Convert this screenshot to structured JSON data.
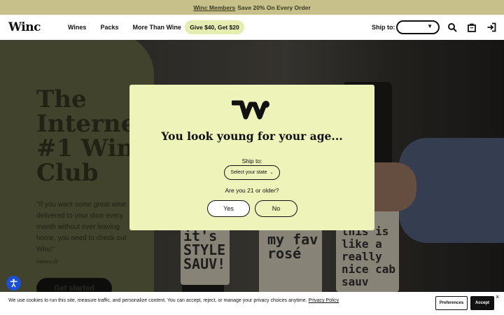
{
  "promo_bar": {
    "link_text": "Winc Members",
    "text": "Save 20% On Every Order"
  },
  "header": {
    "logo": "Winc",
    "nav": [
      {
        "label": "Wines"
      },
      {
        "label": "Packs"
      },
      {
        "label": "More Than Wine"
      }
    ],
    "promo_pill": "Give $40, Get $20",
    "ship_label": "Ship to:",
    "ship_value": "",
    "icons": [
      "search-icon",
      "bag-icon",
      "sign-in-icon"
    ]
  },
  "hero": {
    "title": "The Internet's #1 Wine Club",
    "quote": "\"If you want some great wine delivered to your door every month without ever leaving home, you need to check out Winc\"",
    "quote_source": "Refinery 29",
    "cta": "Get started",
    "bottle_labels": [
      "it's STYLE SAUV!",
      "my fav rosé",
      "this is like a really nice cab sauv"
    ]
  },
  "modal": {
    "logo_letter": "W",
    "title": "You look young for your age...",
    "ship_label": "Ship to:",
    "state_placeholder": "Select your state",
    "question": "Are you 21 or older?",
    "yes": "Yes",
    "no": "No"
  },
  "cookie_banner": {
    "text": "We use cookies to run this site, measure traffic, and personalize content. You can accept, reject, or manage your privacy choices anytime.",
    "link": "Privacy Policy",
    "preferences": "Preferences",
    "accept": "Accept",
    "close": "×"
  },
  "colors": {
    "promo_bar": "#c7c08a",
    "modal_bg": "#edf3b9",
    "promo_pill": "#e6edb0",
    "accessibility": "#1a4fd6"
  }
}
